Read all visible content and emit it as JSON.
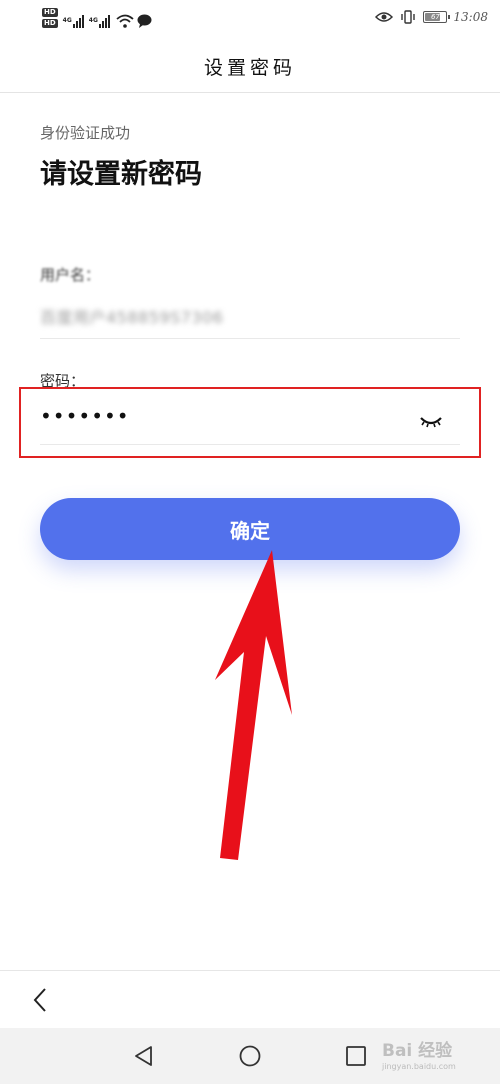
{
  "status_bar": {
    "hd1": "HD",
    "hd2": "HD",
    "net1": "4G",
    "net2": "4G",
    "battery": "67",
    "time": "13:08"
  },
  "header": {
    "title": "设置密码"
  },
  "form": {
    "subtitle": "身份验证成功",
    "title": "请设置新密码",
    "username_label": "用户名：",
    "username_value": "百度用户458859S7306",
    "password_label": "密码：",
    "password_value": "•••••••"
  },
  "confirm_label": "确定",
  "watermark": {
    "main": "Bai 经验",
    "sub": "jingyan.baidu.com"
  },
  "colors": {
    "accent": "#5271ec",
    "highlight": "#e02222",
    "arrow": "#e8101a"
  },
  "icons": [
    "eye-icon",
    "wifi-icon",
    "message-icon",
    "vibrate-icon",
    "battery-icon",
    "back-arrow-icon",
    "nav-back-icon",
    "nav-home-icon",
    "nav-recent-icon"
  ]
}
